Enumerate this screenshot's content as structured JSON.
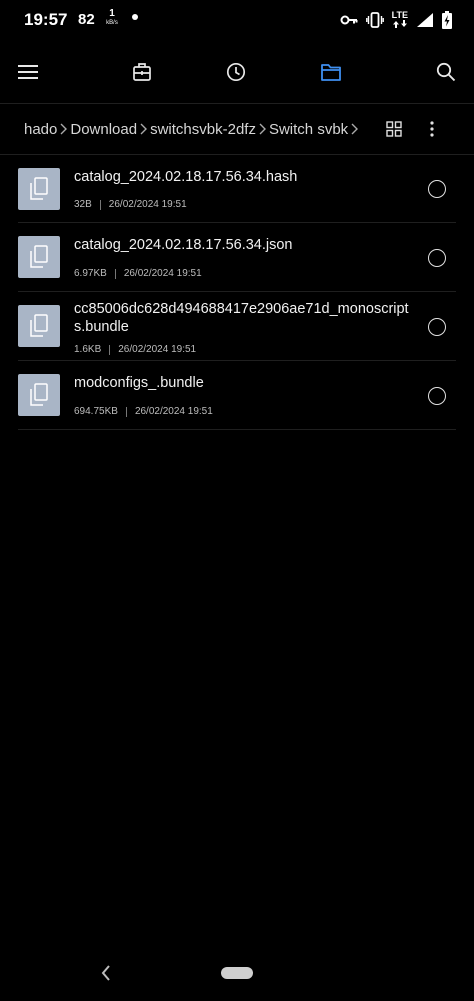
{
  "status_bar": {
    "time": "19:57",
    "notification_count": "82",
    "net_speed_value": "1",
    "net_speed_unit": "kB/s",
    "network_type": "LTE"
  },
  "toolbar": {
    "menu_icon": "menu-icon",
    "categories_icon": "briefcase-icon",
    "recent_icon": "clock-icon",
    "files_icon": "folder-icon",
    "search_icon": "search-icon",
    "active_color": "#3f8ff0"
  },
  "breadcrumb": {
    "segments": [
      "hado",
      "Download",
      "switchsvbk-2dfz",
      "Switch svbk"
    ]
  },
  "files": [
    {
      "name": "catalog_2024.02.18.17.56.34.hash",
      "size": "32B",
      "date": "26/02/2024 19:51"
    },
    {
      "name": "catalog_2024.02.18.17.56.34.json",
      "size": "6.97KB",
      "date": "26/02/2024 19:51"
    },
    {
      "name": "cc85006dc628d494688417e2906ae71d_monoscripts.bundle",
      "size": "1.6KB",
      "date": "26/02/2024 19:51"
    },
    {
      "name": "modconfigs_.bundle",
      "size": "694.75KB",
      "date": "26/02/2024 19:51"
    }
  ]
}
